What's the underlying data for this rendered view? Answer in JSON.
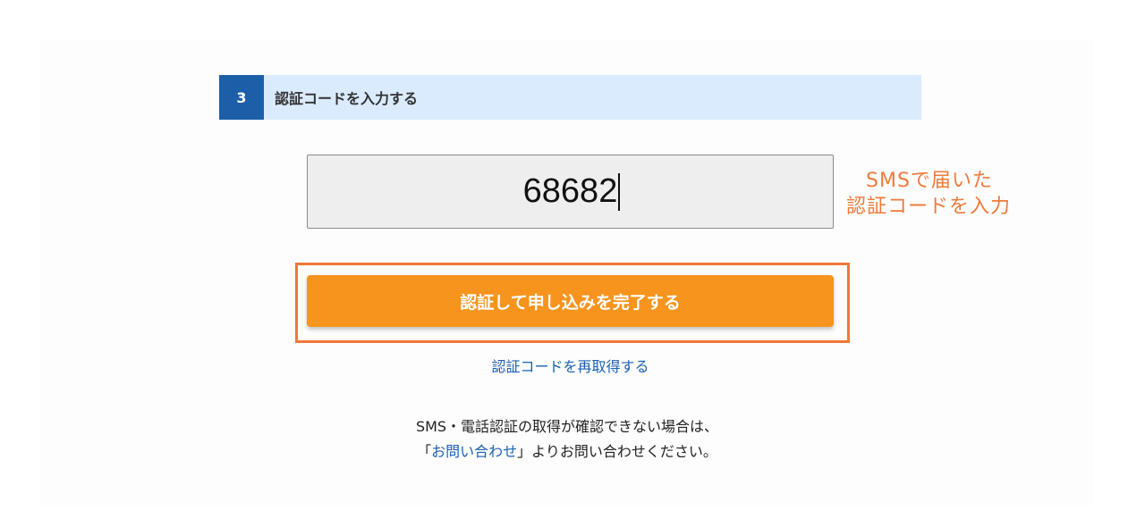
{
  "step": {
    "number": "3",
    "title": "認証コードを入力する"
  },
  "code_input": {
    "value": "68682"
  },
  "annotation": {
    "line1": "SMSで届いた",
    "line2": "認証コードを入力"
  },
  "submit_button": {
    "label": "認証して申し込みを完了する"
  },
  "resend_link": {
    "label": "認証コードを再取得する"
  },
  "notice": {
    "line1": "SMS・電話認証の取得が確認できない場合は、",
    "line2_open": "「",
    "contact_link": "お問い合わせ",
    "line2_close": "」よりお問い合わせください。"
  },
  "colors": {
    "step_badge": "#1c5fa8",
    "step_header_bg": "#d9ebfc",
    "button": "#f7941d",
    "highlight": "#f0773a",
    "link": "#1a5fb4"
  }
}
